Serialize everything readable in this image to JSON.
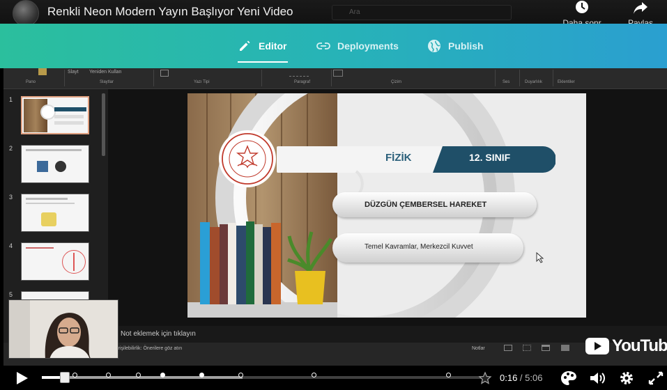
{
  "header": {
    "video_title": "Renkli Neon Modern Yayın Başlıyor Yeni Video",
    "search_placeholder": "Ara",
    "watch_later_label": "Daha sonr",
    "share_label": "Paylaş"
  },
  "nav": {
    "tabs": [
      {
        "label": "Editor",
        "icon": "pencil-icon",
        "active": true
      },
      {
        "label": "Deployments",
        "icon": "link-icon",
        "active": false
      },
      {
        "label": "Publish",
        "icon": "globe-icon",
        "active": false
      }
    ]
  },
  "ribbon": {
    "top_items": [
      "Slayt",
      "Yeniden Kullan"
    ],
    "groups": [
      "Pano",
      "Slaytlar",
      "Yazı Tipi",
      "Paragraf",
      "Çizim",
      "Ses",
      "Duyarlılık",
      "Eklentiler"
    ]
  },
  "thumbnails": [
    {
      "number": "1",
      "selected": true
    },
    {
      "number": "2",
      "selected": false
    },
    {
      "number": "3",
      "selected": false
    },
    {
      "number": "4",
      "selected": false
    },
    {
      "number": "5",
      "selected": false
    }
  ],
  "slide": {
    "subject": "FİZİK",
    "grade": "12. SINIF",
    "topic": "DÜZGÜN ÇEMBERSEL HAREKET",
    "subtopic": "Temel Kavramlar, Merkezcil Kuvvet"
  },
  "notes": {
    "placeholder": "Not eklemek için tıklayın"
  },
  "statusbar": {
    "accessibility": "Erişilebilirlik: Önerilere göz atın",
    "notes_label": "Notlar"
  },
  "player": {
    "current_time": "0:16",
    "separator": " / ",
    "duration": "5:06",
    "progress_fraction": 0.052,
    "loaded_fraction": 0.45,
    "logo_text": "YouTube"
  },
  "colors": {
    "nav_start": "#2bbf9d",
    "nav_end": "#2a9fd0",
    "grade_banner": "#1f4f68",
    "accent_red": "#c0392b"
  }
}
